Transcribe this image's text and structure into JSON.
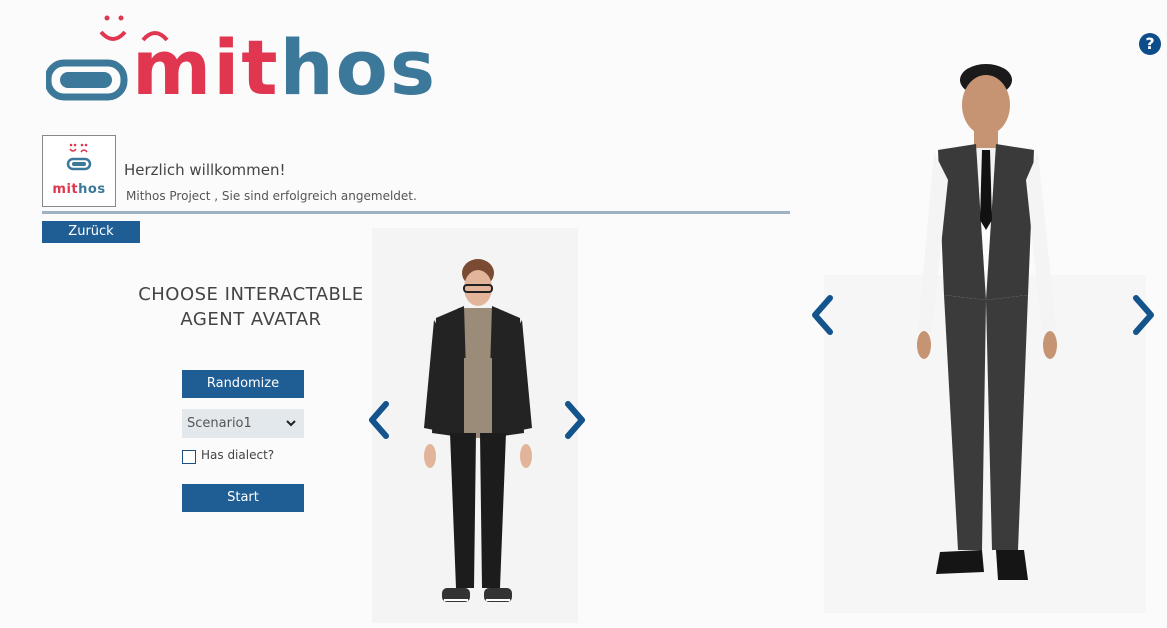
{
  "logo": {
    "part1": "mit",
    "part2": "hos"
  },
  "help": {
    "icon": "question-circle-icon",
    "glyph": "?"
  },
  "user": {
    "badge_part1": "mit",
    "badge_part2": "hos",
    "welcome": "Herzlich willkommen!",
    "status": "Mithos Project , Sie sind erfolgreich angemeldet."
  },
  "nav": {
    "back_label": "Zurück"
  },
  "chooser": {
    "title_line1": "CHOOSE INTERACTABLE",
    "title_line2": "AGENT AVATAR",
    "randomize_label": "Randomize",
    "scenario_value": "Scenario1",
    "dialect_label": "Has dialect?",
    "dialect_checked": false,
    "start_label": "Start"
  },
  "colors": {
    "brand_red": "#e0364f",
    "brand_blue": "#3c789a",
    "button_blue": "#1f5e94",
    "arrow_blue": "#14548d"
  }
}
